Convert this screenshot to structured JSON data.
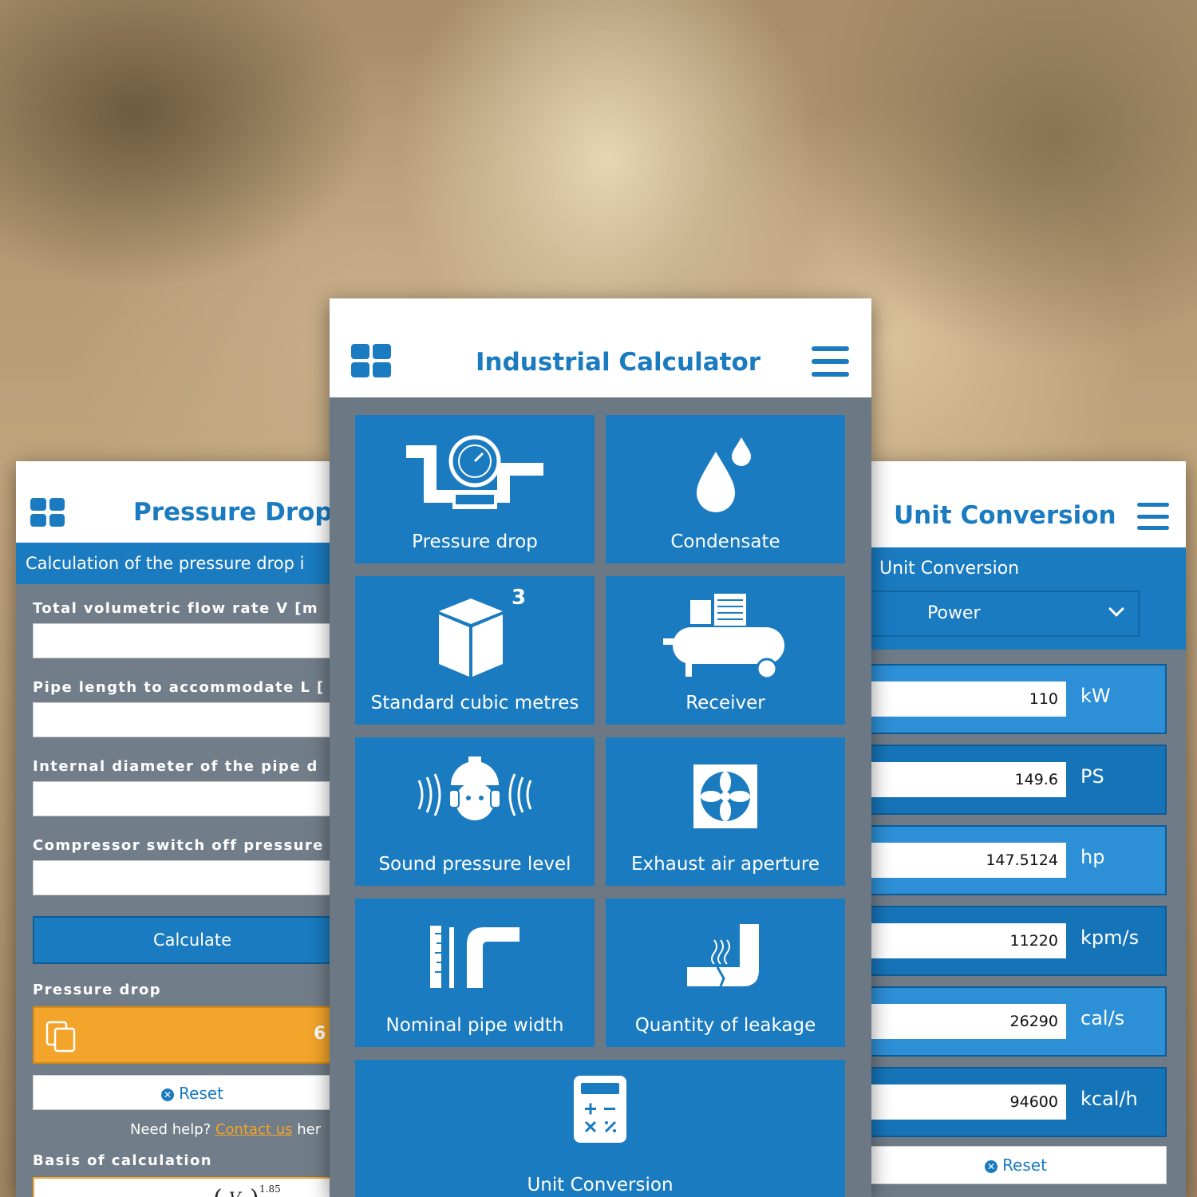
{
  "pressure_drop": {
    "title": "Pressure Drop",
    "description": "Calculation of the pressure drop i",
    "fields": [
      {
        "label": "Total volumetric flow rate V [m"
      },
      {
        "label": "Pipe length to accommodate L ["
      },
      {
        "label": "Internal diameter of the pipe d"
      },
      {
        "label": "Compressor switch off pressure"
      }
    ],
    "calculate_label": "Calculate",
    "result_label": "Pressure drop",
    "result_value": "6",
    "reset_label": "Reset",
    "help_prefix": "Need help? ",
    "help_link": "Contact us",
    "help_suffix": " her",
    "basis_label": "Basis of calculation",
    "formula": {
      "v": "V",
      "exp": "1.85"
    }
  },
  "calculator": {
    "title": "Industrial Calculator",
    "tiles": [
      {
        "label": "Pressure drop",
        "icon": "pressure-gauge-pipe-icon"
      },
      {
        "label": "Condensate",
        "icon": "water-drops-icon"
      },
      {
        "label": "Standard cubic metres",
        "icon": "cube-icon",
        "superscript": "3"
      },
      {
        "label": "Receiver",
        "icon": "air-compressor-icon"
      },
      {
        "label": "Sound pressure level",
        "icon": "worker-ear-protection-icon"
      },
      {
        "label": "Exhaust air aperture",
        "icon": "exhaust-fan-icon"
      },
      {
        "label": "Nominal pipe width",
        "icon": "pipe-ruler-icon"
      },
      {
        "label": "Quantity of leakage",
        "icon": "leaking-pipe-icon"
      },
      {
        "label": "Unit Conversion",
        "icon": "calculator-icon"
      }
    ]
  },
  "unit_conversion": {
    "title": "Unit Conversion",
    "label": "Unit Conversion",
    "selected": "Power",
    "rows": [
      {
        "value": "110",
        "unit": "kW",
        "color": "#2d8fd6"
      },
      {
        "value": "149.6",
        "unit": "PS",
        "color": "#1574b8"
      },
      {
        "value": "147.5124",
        "unit": "hp",
        "color": "#2d8fd6"
      },
      {
        "value": "11220",
        "unit": "kpm/s",
        "color": "#1574b8"
      },
      {
        "value": "26290",
        "unit": "cal/s",
        "color": "#2d8fd6"
      },
      {
        "value": "94600",
        "unit": "kcal/h",
        "color": "#1574b8"
      }
    ],
    "reset_label": "Reset"
  },
  "colors": {
    "accent": "#1a7bc0",
    "result": "#f3a42a",
    "header_bg": "#ffffff"
  }
}
